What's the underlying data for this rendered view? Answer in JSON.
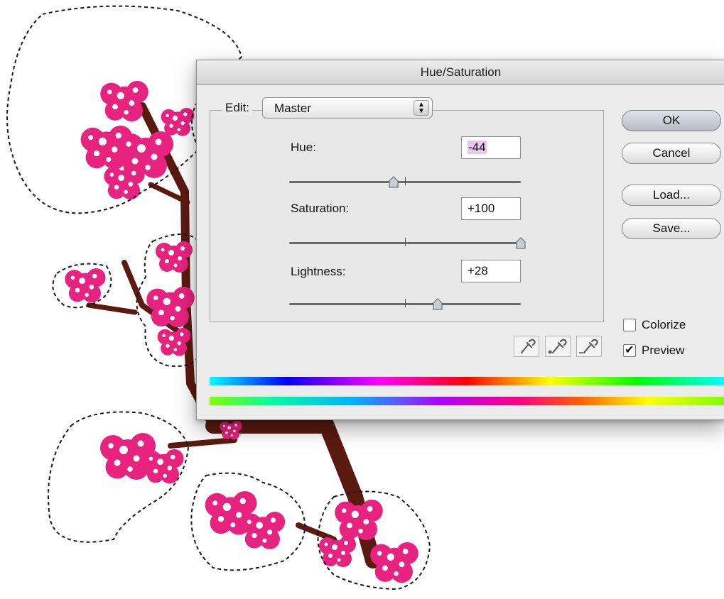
{
  "dialog": {
    "title": "Hue/Saturation",
    "edit": {
      "label": "Edit:",
      "value": "Master"
    },
    "sliders": [
      {
        "label": "Hue:",
        "value": "-44",
        "fraction": 0.45
      },
      {
        "label": "Saturation:",
        "value": "+100",
        "fraction": 1.0
      },
      {
        "label": "Lightness:",
        "value": "+28",
        "fraction": 0.64
      }
    ],
    "buttons": {
      "ok": "OK",
      "cancel": "Cancel",
      "load": "Load...",
      "save": "Save..."
    },
    "options": {
      "colorize": {
        "label": "Colorize",
        "checked": false
      },
      "preview": {
        "label": "Preview",
        "checked": true
      }
    },
    "eyedroppers": [
      "eyedropper-icon",
      "eyedropper-plus-icon",
      "eyedropper-minus-icon"
    ]
  },
  "colors": {
    "blossom": "#e8237f",
    "branch": "#5a1a10",
    "selected_field_highlight": "#e9c6f0",
    "dialog_background": "#ececec"
  }
}
